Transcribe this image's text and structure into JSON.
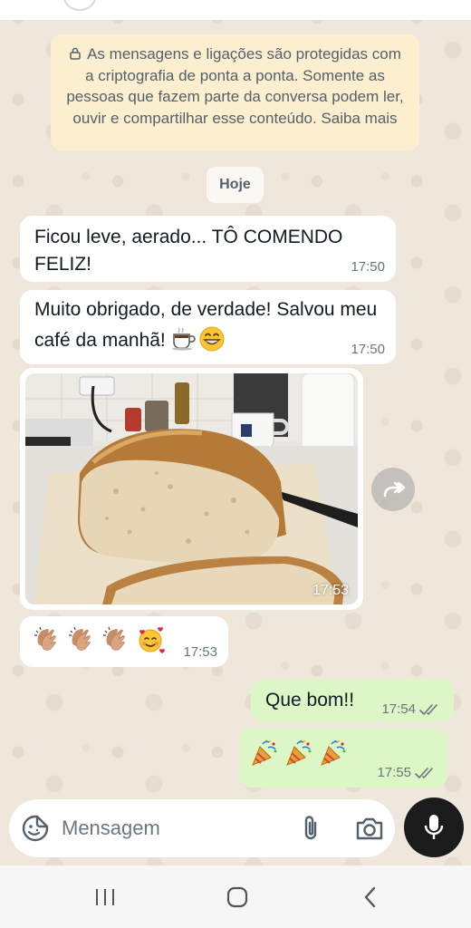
{
  "encryption_notice": {
    "text": "As mensagens e ligações são protegidas com a criptografia de ponta a ponta. Somente as pessoas que fazem parte da conversa podem ler, ouvir e compartilhar esse conteúdo. Saiba mais"
  },
  "date_chip": "Hoje",
  "messages": [
    {
      "direction": "in",
      "text": "Ficou leve, aerado... TÔ COMENDO FELIZ!",
      "time": "17:50"
    },
    {
      "direction": "in",
      "text": "Muito obrigado, de verdade! Salvou meu café da manhã!",
      "emojis": [
        "hot-beverage",
        "grinning-face"
      ],
      "time": "17:50"
    },
    {
      "direction": "in",
      "type": "image",
      "image_description": "loaf of bread",
      "time": "17:53"
    },
    {
      "direction": "in",
      "type": "emoji",
      "emojis": [
        "clapping-hands",
        "clapping-hands",
        "clapping-hands",
        "smiling-face-with-hearts"
      ],
      "time": "17:53"
    },
    {
      "direction": "out",
      "text": "Que bom!!",
      "time": "17:54",
      "status": "read"
    },
    {
      "direction": "out",
      "type": "emoji",
      "emojis": [
        "party-popper",
        "party-popper",
        "party-popper"
      ],
      "time": "17:55",
      "status": "read"
    }
  ],
  "composer": {
    "placeholder": "Mensagem"
  },
  "colors": {
    "incoming_bubble": "#ffffff",
    "outgoing_bubble": "#dcf7c5",
    "read_ticks": "#667781",
    "notice_background": "#fcefd0",
    "mic_button": "#1b1b1b"
  },
  "icons": {
    "composer": [
      "sticker-icon",
      "attach-icon",
      "camera-icon"
    ],
    "send": "mic-icon",
    "nav": [
      "recent-apps-icon",
      "home-icon",
      "back-icon"
    ]
  }
}
